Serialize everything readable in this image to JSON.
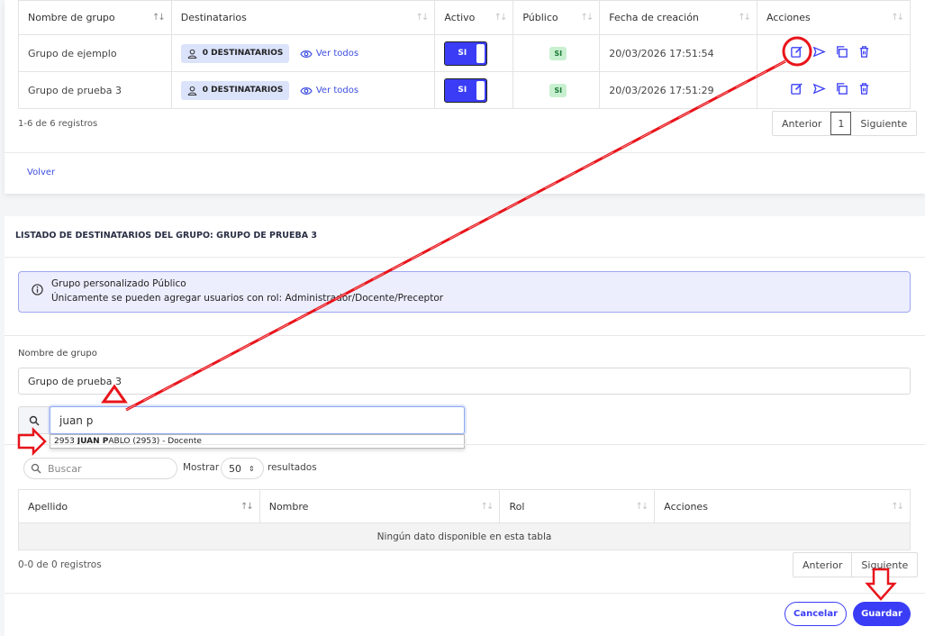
{
  "groups_table": {
    "headers": [
      "Nombre de grupo",
      "Destinatarios",
      "Activo",
      "Público",
      "Fecha de creación",
      "Acciones"
    ],
    "rows": [
      {
        "name": "Grupo de ejemplo",
        "recipients": "0 DESTINATARIOS",
        "view_all": "Ver todos",
        "active": "SI",
        "public": "SI",
        "created": "20/03/2026 17:51:54"
      },
      {
        "name": "Grupo de prueba 3",
        "recipients": "0 DESTINATARIOS",
        "view_all": "Ver todos",
        "active": "SI",
        "public": "SI",
        "created": "20/03/2026 17:51:29"
      }
    ],
    "info": "1-6 de 6 registros",
    "pager": {
      "prev": "Anterior",
      "current": "1",
      "next": "Siguiente"
    }
  },
  "back_link": "Volver",
  "section_title": "LISTADO DE DESTINATARIOS DEL GRUPO: GRUPO DE PRUEBA 3",
  "alert": {
    "title": "Grupo personalizado Público",
    "text": "Únicamente se pueden agregar usuarios con rol: Administrador/Docente/Preceptor"
  },
  "form": {
    "group_name_label": "Nombre de grupo",
    "group_name_value": "Grupo de prueba 3",
    "user_search_value": "juan p",
    "autocomplete": {
      "prefix": "2953 ",
      "bold": "JUAN P",
      "rest": "ABLO (2953) - Docente"
    }
  },
  "recipients_table": {
    "search_placeholder": "Buscar",
    "show_label": "Mostrar",
    "page_size": "50",
    "results_label": "resultados",
    "headers": [
      "Apellido",
      "Nombre",
      "Rol",
      "Acciones"
    ],
    "empty": "Ningún dato disponible en esta tabla",
    "info": "0-0 de 0 registros",
    "pager": {
      "prev": "Anterior",
      "next": "Siguiente"
    }
  },
  "buttons": {
    "cancel": "Cancelar",
    "save": "Guardar"
  },
  "colors": {
    "accent": "#3a3df5",
    "annotation": "#e8141b",
    "success_bg": "#c8f0d0"
  }
}
